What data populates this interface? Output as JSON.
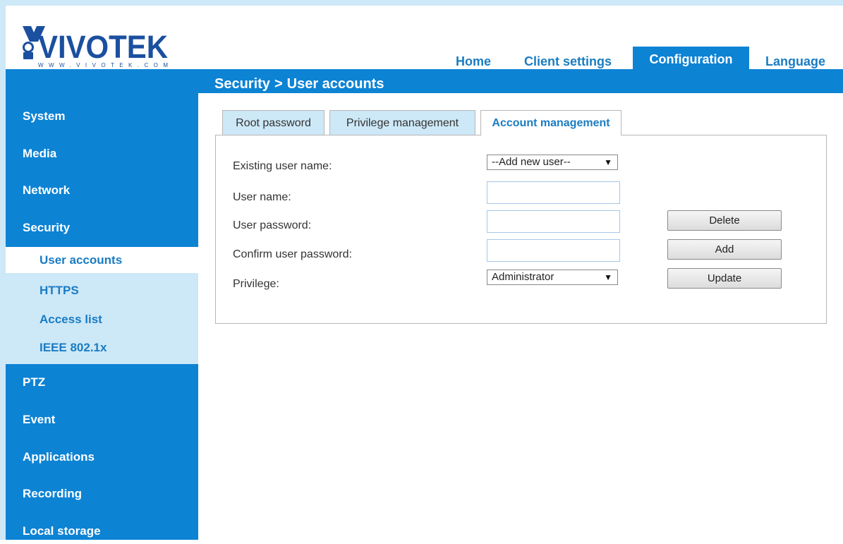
{
  "logo": {
    "brand": "VIVOTEK",
    "url_text": "WWW.VIVOTEK.COM"
  },
  "topnav": {
    "home": "Home",
    "client_settings": "Client settings",
    "configuration": "Configuration",
    "language": "Language"
  },
  "breadcrumb": {
    "section": "Security",
    "separator": ">",
    "page": "User accounts"
  },
  "sidebar": {
    "system": "System",
    "media": "Media",
    "network": "Network",
    "security": "Security",
    "security_sub": [
      "User accounts",
      "HTTPS",
      "Access list",
      "IEEE 802.1x"
    ],
    "ptz": "PTZ",
    "event": "Event",
    "applications": "Applications",
    "recording": "Recording",
    "local_storage": "Local storage"
  },
  "tabs": {
    "root_password": "Root password",
    "privilege_management": "Privilege management",
    "account_management": "Account management"
  },
  "form": {
    "existing_user_label": "Existing user name:",
    "existing_user_value": "--Add new user--",
    "user_name_label": "User name:",
    "user_name_value": "",
    "user_password_label": "User password:",
    "user_password_value": "",
    "confirm_password_label": "Confirm user password:",
    "confirm_password_value": "",
    "privilege_label": "Privilege:",
    "privilege_value": "Administrator"
  },
  "buttons": {
    "delete": "Delete",
    "add": "Add",
    "update": "Update"
  },
  "colors": {
    "accent": "#0d83d4",
    "light": "#cde8f7",
    "link": "#1a7cc3"
  }
}
